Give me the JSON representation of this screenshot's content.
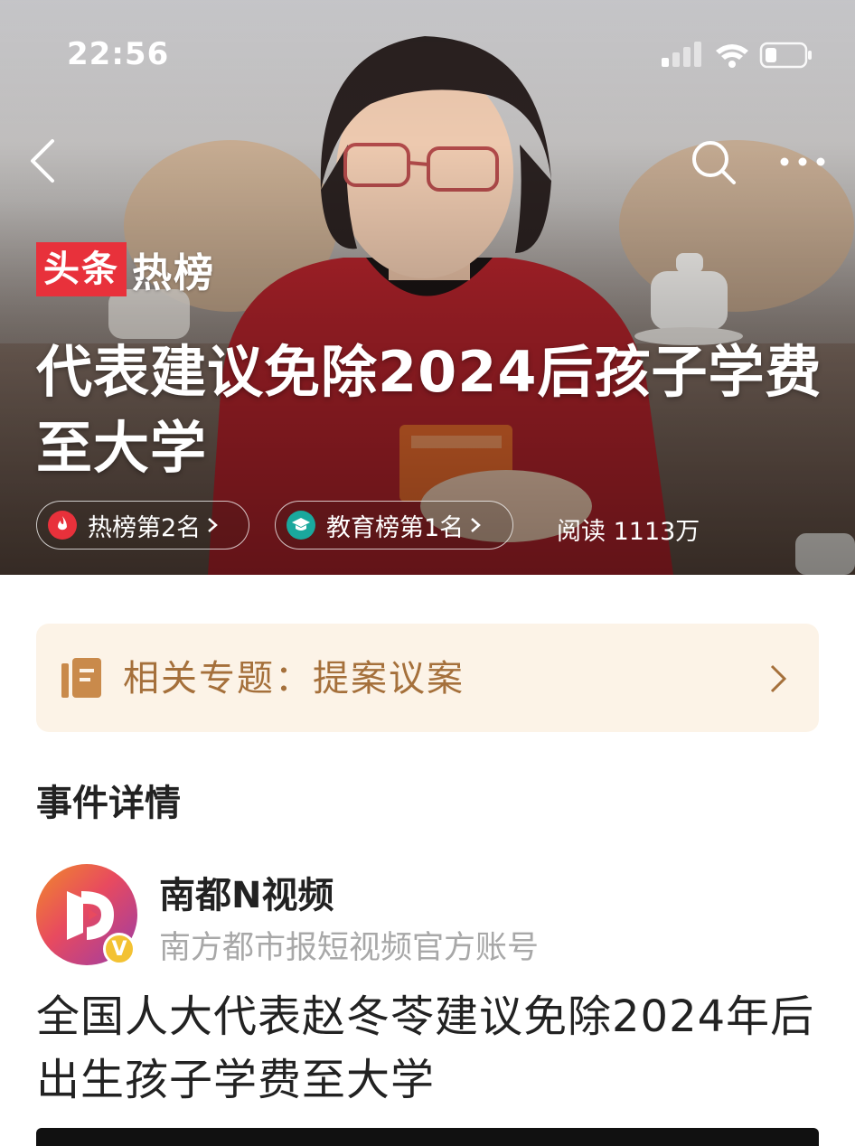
{
  "status_bar": {
    "time": "22:56"
  },
  "brand": {
    "left": "头条",
    "right": "热榜"
  },
  "hero": {
    "title": "代表建议免除2024后孩子学费至大学",
    "tags": [
      {
        "label": "热榜第2名",
        "icon": "flame-icon",
        "color": "#e8313b"
      },
      {
        "label": "教育榜第1名",
        "icon": "graduation-cap-icon",
        "color": "#1aa89d"
      }
    ],
    "read_count": "阅读 1113万"
  },
  "topic": {
    "label": "相关专题：提案议案"
  },
  "event": {
    "section_title": "事件详情",
    "author_name": "南都N视频",
    "author_desc": "南方都市报短视频官方账号",
    "verified_mark": "V",
    "headline": "全国人大代表赵冬苓建议免除2024年后出生孩子学费至大学"
  },
  "colors": {
    "brand_red": "#e8313b",
    "topic_bg": "#fcf3e7",
    "topic_text": "#a5703b"
  }
}
